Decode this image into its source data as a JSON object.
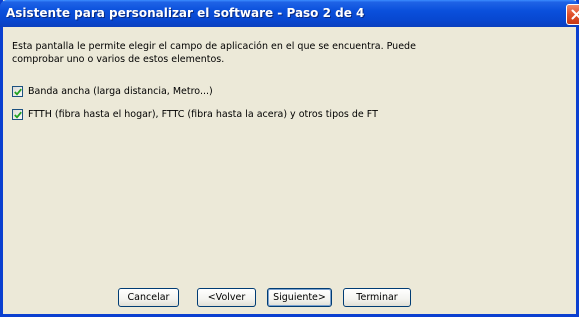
{
  "window": {
    "title": "Asistente para personalizar el software - Paso 2 de 4"
  },
  "intro_text": {
    "line1": "Esta pantalla le permite elegir el campo de aplicación en el que se encuentra. Puede",
    "line2": "comprobar uno o varios de estos elementos."
  },
  "options": [
    {
      "label": "Banda ancha (larga distancia, Metro...)",
      "checked": true
    },
    {
      "label": "FTTH (fibra hasta el hogar), FTTC (fibra hasta la acera) y otros tipos de FT",
      "checked": true
    }
  ],
  "buttons": {
    "cancel": "Cancelar",
    "back": "<Volver",
    "next": "Siguiente>",
    "finish": "Terminar"
  },
  "icons": {
    "close": "close-icon",
    "check": "checkmark-icon"
  },
  "colors": {
    "titlebar": "#0A50DC",
    "window_bg": "#ECE9D8",
    "close_button": "#E0502A",
    "button_border": "#003C74",
    "checkmark": "#21A121"
  }
}
